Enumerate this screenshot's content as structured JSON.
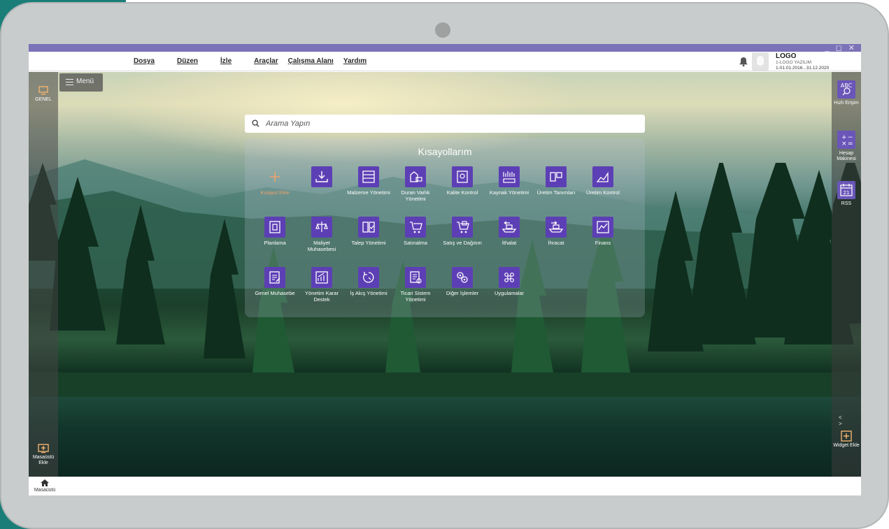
{
  "window": {
    "controls": "_ ◻ ✕"
  },
  "menubar": {
    "items": [
      {
        "label": "Dosya"
      },
      {
        "label": "Düzen"
      },
      {
        "label": "İzle"
      },
      {
        "label": "Araçlar"
      },
      {
        "label": "Çalışma Alanı"
      },
      {
        "label": "Yardım"
      }
    ]
  },
  "company": {
    "name": "LOGO",
    "sub": "1-LOGO YAZILIM",
    "period": "1-01.01.2016...31.12.2020"
  },
  "left_rail": {
    "top": {
      "label": "GENEL",
      "icon": "monitor-icon"
    },
    "bottom": {
      "label": "Masaüstü Ekle",
      "icon": "add-icon"
    }
  },
  "menu_button": {
    "label": "Menü"
  },
  "search": {
    "placeholder": "Arama Yapın"
  },
  "shortcuts": {
    "title": "Kısayollarım",
    "tiles": [
      {
        "label": "Kısayol Ekle",
        "icon": "add-shortcut-icon"
      },
      {
        "label": "",
        "icon": "download-icon"
      },
      {
        "label": "Malzeme Yönetimi",
        "icon": "material-icon"
      },
      {
        "label": "Duran Varlık Yönetimi",
        "icon": "asset-icon"
      },
      {
        "label": "Kalite Kontrol",
        "icon": "quality-icon"
      },
      {
        "label": "Kaynak Yönetimi",
        "icon": "resource-icon"
      },
      {
        "label": "Üretim Tanımları",
        "icon": "production-def-icon"
      },
      {
        "label": "Üretim Kontrol",
        "icon": "production-control-icon"
      },
      {
        "label": "Planlama",
        "icon": "planning-icon"
      },
      {
        "label": "Maliyet Muhasebesi",
        "icon": "cost-icon"
      },
      {
        "label": "Talep Yönetimi",
        "icon": "request-icon"
      },
      {
        "label": "Satınalma",
        "icon": "purchase-icon"
      },
      {
        "label": "Satış ve Dağıtım",
        "icon": "sales-icon"
      },
      {
        "label": "İthalat",
        "icon": "import-icon"
      },
      {
        "label": "İhracat",
        "icon": "export-icon"
      },
      {
        "label": "Finans",
        "icon": "finance-icon"
      },
      {
        "label": "Genel Muhasebe",
        "icon": "accounting-icon"
      },
      {
        "label": "Yönetim Karar Destek",
        "icon": "decision-icon"
      },
      {
        "label": "İş Akış Yönetimi",
        "icon": "workflow-icon"
      },
      {
        "label": "Ticari Sistem Yönetimi",
        "icon": "commerce-icon"
      },
      {
        "label": "Diğer İşlemler",
        "icon": "gears-icon"
      },
      {
        "label": "Uygulamalar",
        "icon": "apps-icon"
      }
    ]
  },
  "right_rail": {
    "items": [
      {
        "label": "Hızlı Erişim",
        "icon": "abc-search-icon"
      },
      {
        "label": "Hesap Makinesi",
        "icon": "calculator-icon"
      },
      {
        "label": "RSS",
        "icon": "calendar-icon"
      }
    ],
    "paging": "< >",
    "widget_add": {
      "label": "Widget Ekle",
      "icon": "add-icon"
    }
  },
  "taskbar": {
    "home_label": "Masaüstü"
  },
  "colors": {
    "accent": "#5d3fb5",
    "top_strip": "#7b72b8",
    "add_label": "#f0a26b"
  }
}
